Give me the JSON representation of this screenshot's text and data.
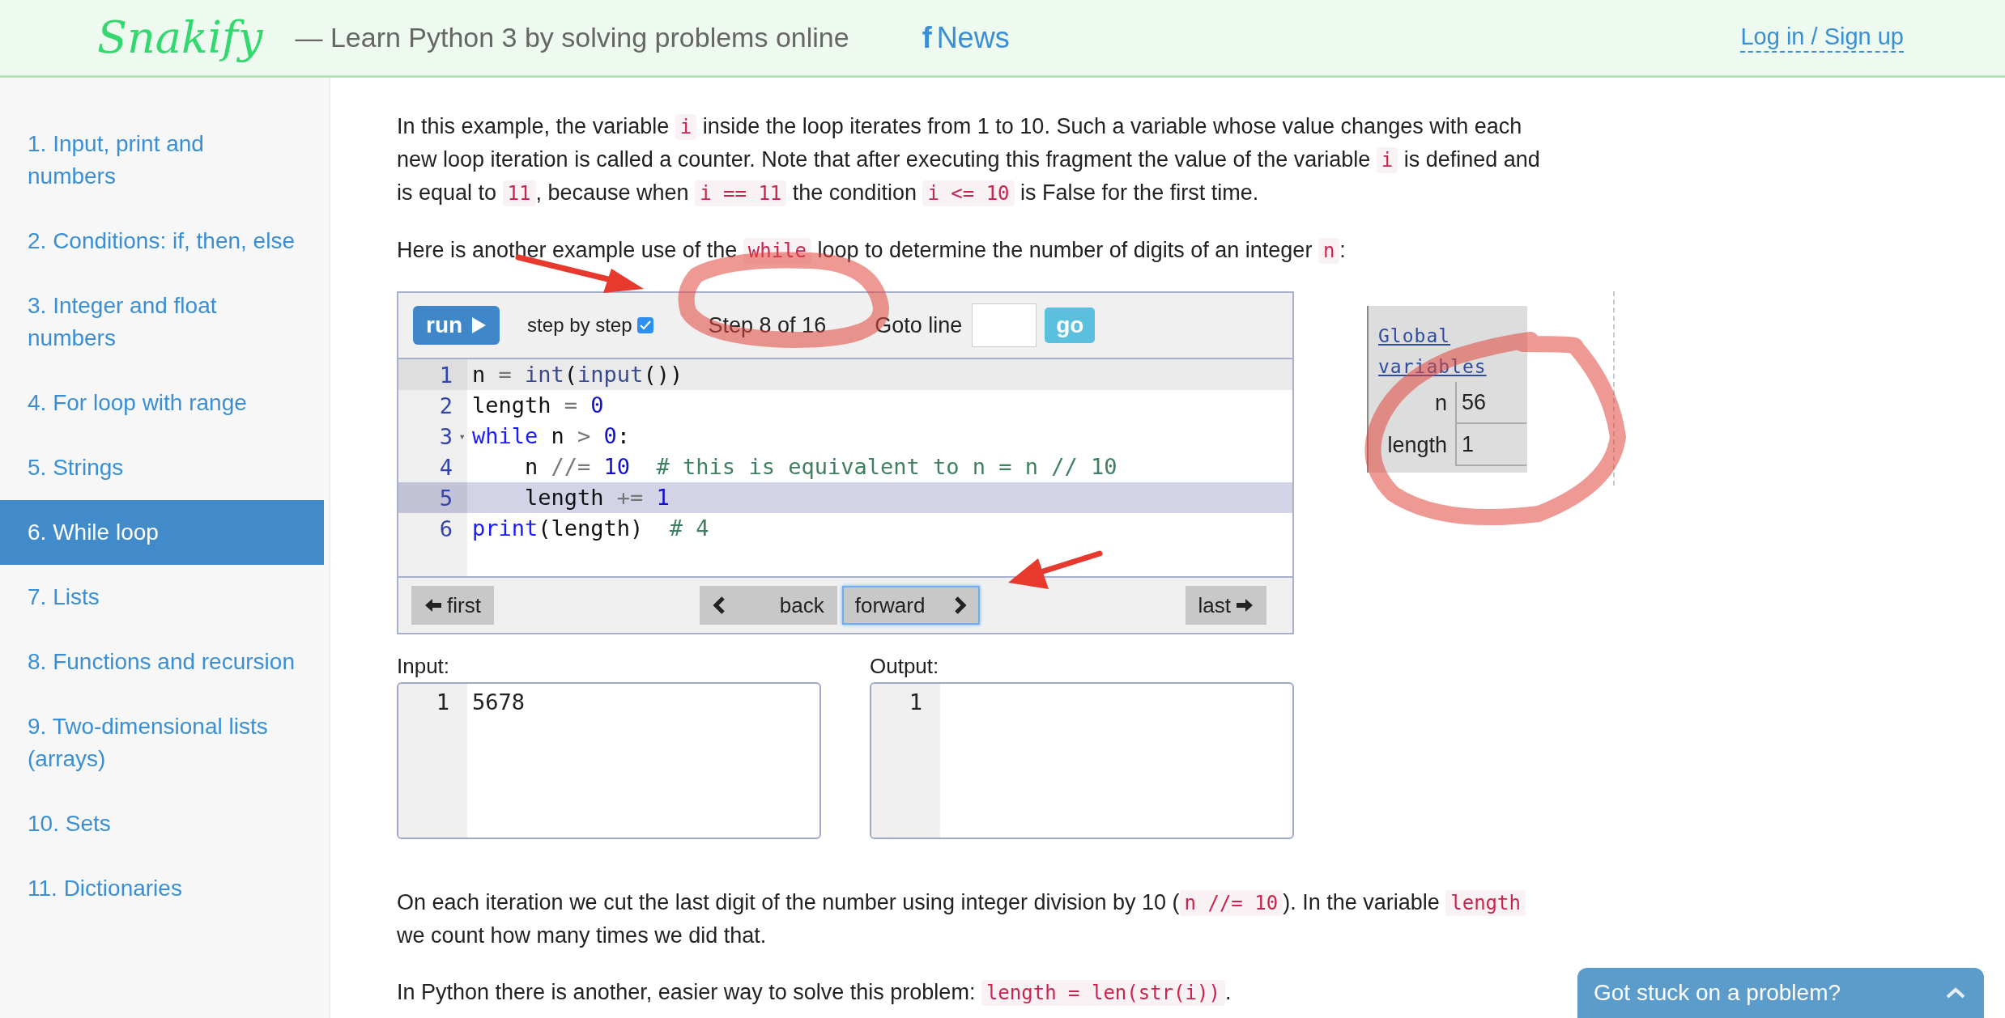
{
  "header": {
    "logo": "Snakify",
    "tagline": "— Learn Python 3 by solving problems online",
    "news_icon": "f",
    "news": "News",
    "login": "Log in / Sign up"
  },
  "sidebar": {
    "items": [
      {
        "label": "1. Input, print and numbers",
        "selected": false
      },
      {
        "label": "2. Conditions: if, then, else",
        "selected": false
      },
      {
        "label": "3. Integer and float numbers",
        "selected": false
      },
      {
        "label": "4. For loop with range",
        "selected": false
      },
      {
        "label": "5. Strings",
        "selected": false
      },
      {
        "label": "6. While loop",
        "selected": true
      },
      {
        "label": "7. Lists",
        "selected": false
      },
      {
        "label": "8. Functions and recursion",
        "selected": false
      },
      {
        "label": "9. Two-dimensional lists (arrays)",
        "selected": false
      },
      {
        "label": "10. Sets",
        "selected": false
      },
      {
        "label": "11. Dictionaries",
        "selected": false
      }
    ]
  },
  "intro": [
    [
      {
        "kind": "text",
        "text": "In this example, the variable "
      },
      {
        "kind": "code",
        "text": "i"
      },
      {
        "kind": "text",
        "text": " inside the loop iterates from 1 to 10. Such a variable whose value changes with each new loop iteration is called a counter. Note that after executing this fragment the value of the variable "
      },
      {
        "kind": "code",
        "text": "i"
      },
      {
        "kind": "text",
        "text": " is defined and is equal to "
      },
      {
        "kind": "code",
        "text": "11"
      },
      {
        "kind": "text",
        "text": ", because when "
      },
      {
        "kind": "code",
        "text": "i == 11"
      },
      {
        "kind": "text",
        "text": " the condition "
      },
      {
        "kind": "code",
        "text": "i <= 10"
      },
      {
        "kind": "text",
        "text": " is False for the first time."
      }
    ],
    [
      {
        "kind": "text",
        "text": "Here is another example use of the "
      },
      {
        "kind": "code",
        "text": "while"
      },
      {
        "kind": "text",
        "text": " loop to determine the number of digits of an integer "
      },
      {
        "kind": "code",
        "text": "n"
      },
      {
        "kind": "text",
        "text": ":"
      }
    ]
  ],
  "visualizer": {
    "run": "run",
    "step_by_step": {
      "label": "step by step",
      "checked": true
    },
    "step": "Step 8 of 16",
    "goto_label": "Goto line",
    "go": "go",
    "lines": [
      {
        "number": "1",
        "cursor": true,
        "current": false,
        "tokens": [
          {
            "kind": "plain",
            "text": "n"
          },
          {
            "kind": "op",
            "text": " = "
          },
          {
            "kind": "builtin",
            "text": "int"
          },
          {
            "kind": "plain",
            "text": "("
          },
          {
            "kind": "builtin",
            "text": "input"
          },
          {
            "kind": "plain",
            "text": "())"
          }
        ]
      },
      {
        "number": "2",
        "cursor": false,
        "current": false,
        "tokens": [
          {
            "kind": "plain",
            "text": "length"
          },
          {
            "kind": "op",
            "text": " = "
          },
          {
            "kind": "number",
            "text": "0"
          }
        ]
      },
      {
        "number": "3",
        "fold": "▾",
        "cursor": false,
        "current": false,
        "tokens": [
          {
            "kind": "keyword",
            "text": "while"
          },
          {
            "kind": "plain",
            "text": " n"
          },
          {
            "kind": "op",
            "text": " > "
          },
          {
            "kind": "number",
            "text": "0"
          },
          {
            "kind": "plain",
            "text": ":"
          }
        ]
      },
      {
        "number": "4",
        "cursor": false,
        "current": false,
        "tokens": [
          {
            "kind": "plain",
            "text": "    n"
          },
          {
            "kind": "op",
            "text": " //= "
          },
          {
            "kind": "number",
            "text": "10"
          },
          {
            "kind": "comment",
            "text": "  # this is equivalent to n = n // 10"
          }
        ]
      },
      {
        "number": "5",
        "cursor": false,
        "current": true,
        "tokens": [
          {
            "kind": "plain",
            "text": "    length"
          },
          {
            "kind": "op",
            "text": " += "
          },
          {
            "kind": "number",
            "text": "1"
          }
        ]
      },
      {
        "number": "6",
        "cursor": false,
        "current": false,
        "tokens": [
          {
            "kind": "keyword",
            "text": "print"
          },
          {
            "kind": "plain",
            "text": "(length)  "
          },
          {
            "kind": "comment",
            "text": "# 4"
          }
        ]
      }
    ],
    "nav": [
      {
        "kind": "first",
        "label": "first",
        "focused": false
      },
      {
        "kind": "back",
        "label": "back",
        "focused": false
      },
      {
        "kind": "forward",
        "label": "forward",
        "focused": true
      },
      {
        "kind": "last",
        "label": "last",
        "focused": false
      }
    ]
  },
  "globals": {
    "title": "Global variables",
    "variables": [
      {
        "name": "n",
        "value": "56"
      },
      {
        "name": "length",
        "value": "1"
      }
    ]
  },
  "input": {
    "label": "Input:",
    "lines": [
      {
        "number": "1",
        "text": "5678"
      }
    ]
  },
  "output": {
    "label": "Output:",
    "lines": [
      {
        "number": "1"
      }
    ]
  },
  "after": [
    [
      {
        "kind": "text",
        "text": "On each iteration we cut the last digit of the number using integer division by 10 ("
      },
      {
        "kind": "code",
        "text": "n //= 10"
      },
      {
        "kind": "text",
        "text": "). In the variable "
      },
      {
        "kind": "code",
        "text": "length"
      },
      {
        "kind": "text",
        "text": " we count how many times we did that."
      }
    ],
    [
      {
        "kind": "text",
        "text": "In Python there is another, easier way to solve this problem: "
      },
      {
        "kind": "code",
        "text": "length = len(str(i))"
      },
      {
        "kind": "text",
        "text": "."
      }
    ]
  ],
  "help_tab": {
    "label": "Got stuck on a problem?"
  }
}
